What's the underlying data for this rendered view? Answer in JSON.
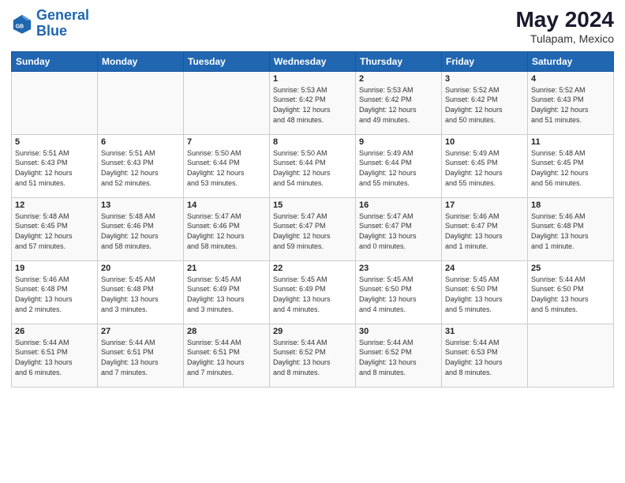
{
  "header": {
    "logo_line1": "General",
    "logo_line2": "Blue",
    "title": "May 2024",
    "subtitle": "Tulapam, Mexico"
  },
  "days_of_week": [
    "Sunday",
    "Monday",
    "Tuesday",
    "Wednesday",
    "Thursday",
    "Friday",
    "Saturday"
  ],
  "weeks": [
    [
      {
        "day": "",
        "info": ""
      },
      {
        "day": "",
        "info": ""
      },
      {
        "day": "",
        "info": ""
      },
      {
        "day": "1",
        "info": "Sunrise: 5:53 AM\nSunset: 6:42 PM\nDaylight: 12 hours\nand 48 minutes."
      },
      {
        "day": "2",
        "info": "Sunrise: 5:53 AM\nSunset: 6:42 PM\nDaylight: 12 hours\nand 49 minutes."
      },
      {
        "day": "3",
        "info": "Sunrise: 5:52 AM\nSunset: 6:42 PM\nDaylight: 12 hours\nand 50 minutes."
      },
      {
        "day": "4",
        "info": "Sunrise: 5:52 AM\nSunset: 6:43 PM\nDaylight: 12 hours\nand 51 minutes."
      }
    ],
    [
      {
        "day": "5",
        "info": "Sunrise: 5:51 AM\nSunset: 6:43 PM\nDaylight: 12 hours\nand 51 minutes."
      },
      {
        "day": "6",
        "info": "Sunrise: 5:51 AM\nSunset: 6:43 PM\nDaylight: 12 hours\nand 52 minutes."
      },
      {
        "day": "7",
        "info": "Sunrise: 5:50 AM\nSunset: 6:44 PM\nDaylight: 12 hours\nand 53 minutes."
      },
      {
        "day": "8",
        "info": "Sunrise: 5:50 AM\nSunset: 6:44 PM\nDaylight: 12 hours\nand 54 minutes."
      },
      {
        "day": "9",
        "info": "Sunrise: 5:49 AM\nSunset: 6:44 PM\nDaylight: 12 hours\nand 55 minutes."
      },
      {
        "day": "10",
        "info": "Sunrise: 5:49 AM\nSunset: 6:45 PM\nDaylight: 12 hours\nand 55 minutes."
      },
      {
        "day": "11",
        "info": "Sunrise: 5:48 AM\nSunset: 6:45 PM\nDaylight: 12 hours\nand 56 minutes."
      }
    ],
    [
      {
        "day": "12",
        "info": "Sunrise: 5:48 AM\nSunset: 6:45 PM\nDaylight: 12 hours\nand 57 minutes."
      },
      {
        "day": "13",
        "info": "Sunrise: 5:48 AM\nSunset: 6:46 PM\nDaylight: 12 hours\nand 58 minutes."
      },
      {
        "day": "14",
        "info": "Sunrise: 5:47 AM\nSunset: 6:46 PM\nDaylight: 12 hours\nand 58 minutes."
      },
      {
        "day": "15",
        "info": "Sunrise: 5:47 AM\nSunset: 6:47 PM\nDaylight: 12 hours\nand 59 minutes."
      },
      {
        "day": "16",
        "info": "Sunrise: 5:47 AM\nSunset: 6:47 PM\nDaylight: 13 hours\nand 0 minutes."
      },
      {
        "day": "17",
        "info": "Sunrise: 5:46 AM\nSunset: 6:47 PM\nDaylight: 13 hours\nand 1 minute."
      },
      {
        "day": "18",
        "info": "Sunrise: 5:46 AM\nSunset: 6:48 PM\nDaylight: 13 hours\nand 1 minute."
      }
    ],
    [
      {
        "day": "19",
        "info": "Sunrise: 5:46 AM\nSunset: 6:48 PM\nDaylight: 13 hours\nand 2 minutes."
      },
      {
        "day": "20",
        "info": "Sunrise: 5:45 AM\nSunset: 6:48 PM\nDaylight: 13 hours\nand 3 minutes."
      },
      {
        "day": "21",
        "info": "Sunrise: 5:45 AM\nSunset: 6:49 PM\nDaylight: 13 hours\nand 3 minutes."
      },
      {
        "day": "22",
        "info": "Sunrise: 5:45 AM\nSunset: 6:49 PM\nDaylight: 13 hours\nand 4 minutes."
      },
      {
        "day": "23",
        "info": "Sunrise: 5:45 AM\nSunset: 6:50 PM\nDaylight: 13 hours\nand 4 minutes."
      },
      {
        "day": "24",
        "info": "Sunrise: 5:45 AM\nSunset: 6:50 PM\nDaylight: 13 hours\nand 5 minutes."
      },
      {
        "day": "25",
        "info": "Sunrise: 5:44 AM\nSunset: 6:50 PM\nDaylight: 13 hours\nand 5 minutes."
      }
    ],
    [
      {
        "day": "26",
        "info": "Sunrise: 5:44 AM\nSunset: 6:51 PM\nDaylight: 13 hours\nand 6 minutes."
      },
      {
        "day": "27",
        "info": "Sunrise: 5:44 AM\nSunset: 6:51 PM\nDaylight: 13 hours\nand 7 minutes."
      },
      {
        "day": "28",
        "info": "Sunrise: 5:44 AM\nSunset: 6:51 PM\nDaylight: 13 hours\nand 7 minutes."
      },
      {
        "day": "29",
        "info": "Sunrise: 5:44 AM\nSunset: 6:52 PM\nDaylight: 13 hours\nand 8 minutes."
      },
      {
        "day": "30",
        "info": "Sunrise: 5:44 AM\nSunset: 6:52 PM\nDaylight: 13 hours\nand 8 minutes."
      },
      {
        "day": "31",
        "info": "Sunrise: 5:44 AM\nSunset: 6:53 PM\nDaylight: 13 hours\nand 8 minutes."
      },
      {
        "day": "",
        "info": ""
      }
    ]
  ]
}
